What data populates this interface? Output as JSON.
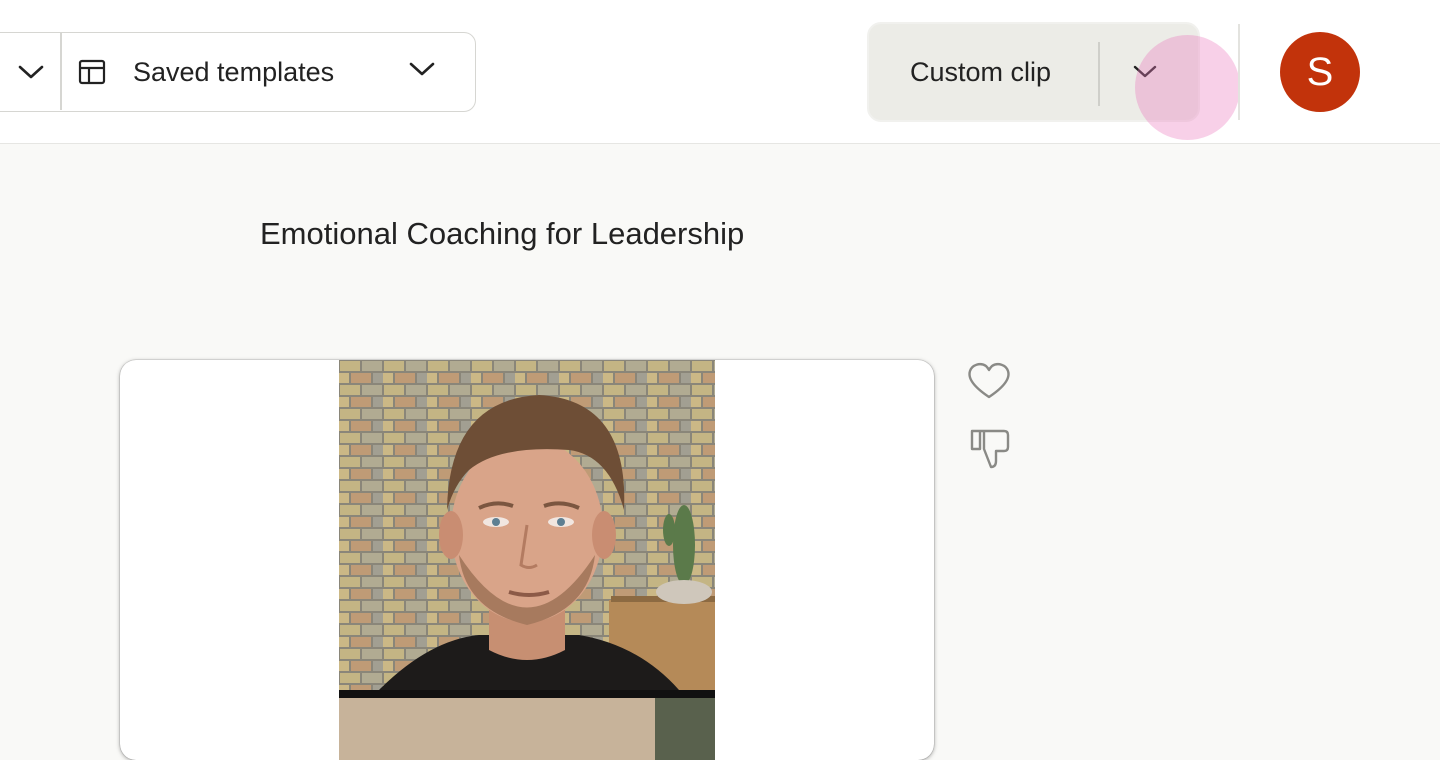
{
  "toolbar": {
    "templates_label": "Saved templates",
    "custom_clip_label": "Custom clip"
  },
  "user": {
    "avatar_initial": "S",
    "avatar_color": "#c2330b"
  },
  "main": {
    "title": "Emotional Coaching for Leadership"
  },
  "icons": {
    "prev": "chevron-down-icon",
    "templates": "layout-template-icon",
    "templates_dropdown": "chevron-down-icon",
    "custom_clip_dropdown": "chevron-down-icon",
    "like": "heart-icon",
    "dislike": "thumbs-down-icon"
  },
  "colors": {
    "accent": "#c2330b",
    "click_indicator": "#ec78be"
  }
}
